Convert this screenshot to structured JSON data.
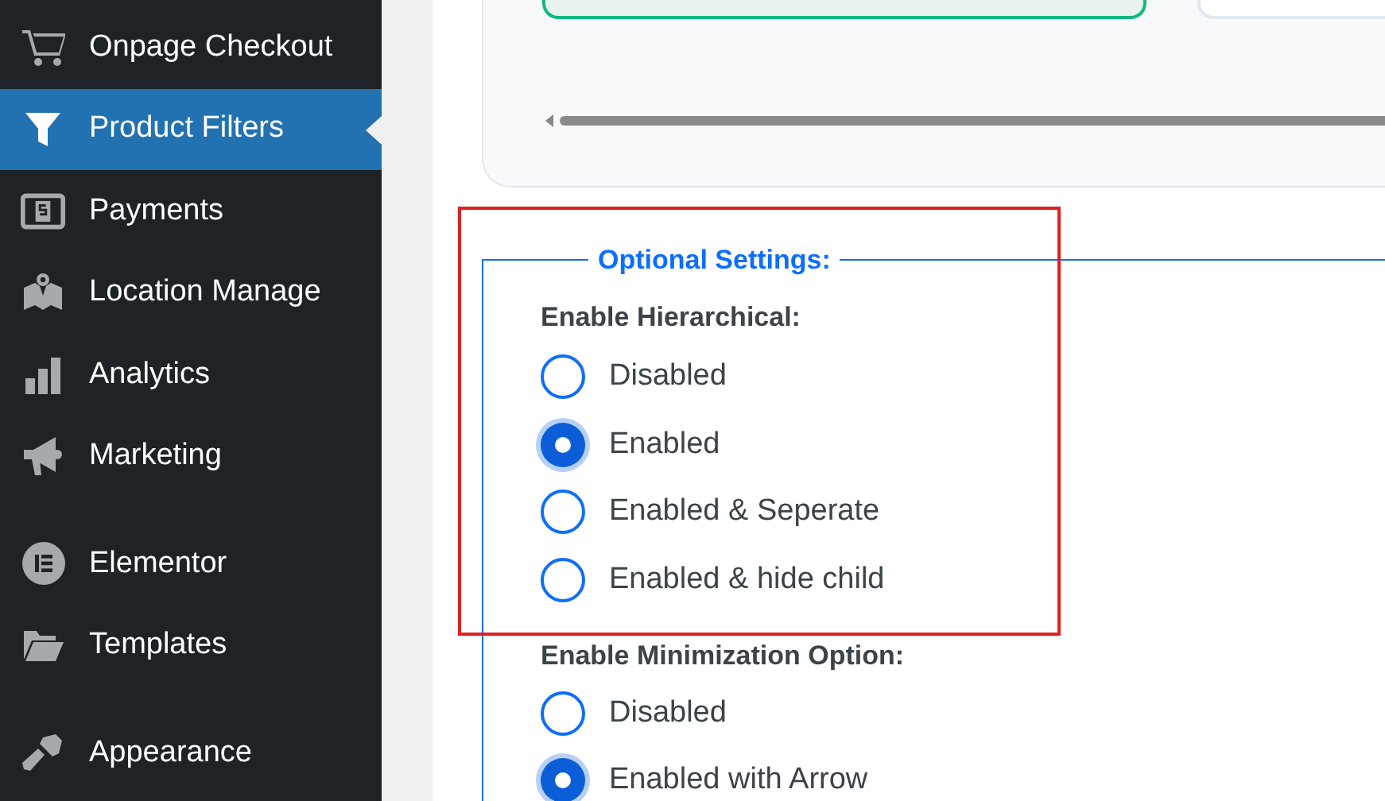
{
  "sidebar": {
    "groups": [
      {
        "items": [
          {
            "label": "Onpage Checkout",
            "selected": false
          },
          {
            "label": "Product Filters",
            "selected": true
          },
          {
            "label": "Payments",
            "selected": false
          },
          {
            "label": "Location Manage",
            "selected": false
          },
          {
            "label": "Analytics",
            "selected": false
          },
          {
            "label": "Marketing",
            "selected": false
          }
        ]
      },
      {
        "items": [
          {
            "label": "Elementor",
            "selected": false
          },
          {
            "label": "Templates",
            "selected": false
          }
        ]
      },
      {
        "items": [
          {
            "label": "Appearance",
            "selected": false
          }
        ]
      }
    ]
  },
  "optional_settings": {
    "legend": "Optional Settings:",
    "groups": [
      {
        "label": "Enable Hierarchical:",
        "options": [
          {
            "label": "Disabled",
            "selected": false
          },
          {
            "label": "Enabled",
            "selected": true
          },
          {
            "label": "Enabled & Seperate",
            "selected": false
          },
          {
            "label": "Enabled & hide child",
            "selected": false
          }
        ]
      },
      {
        "label": "Enable Minimization Option:",
        "options": [
          {
            "label": "Disabled",
            "selected": false
          },
          {
            "label": "Enabled with Arrow",
            "selected": true
          }
        ]
      }
    ]
  }
}
